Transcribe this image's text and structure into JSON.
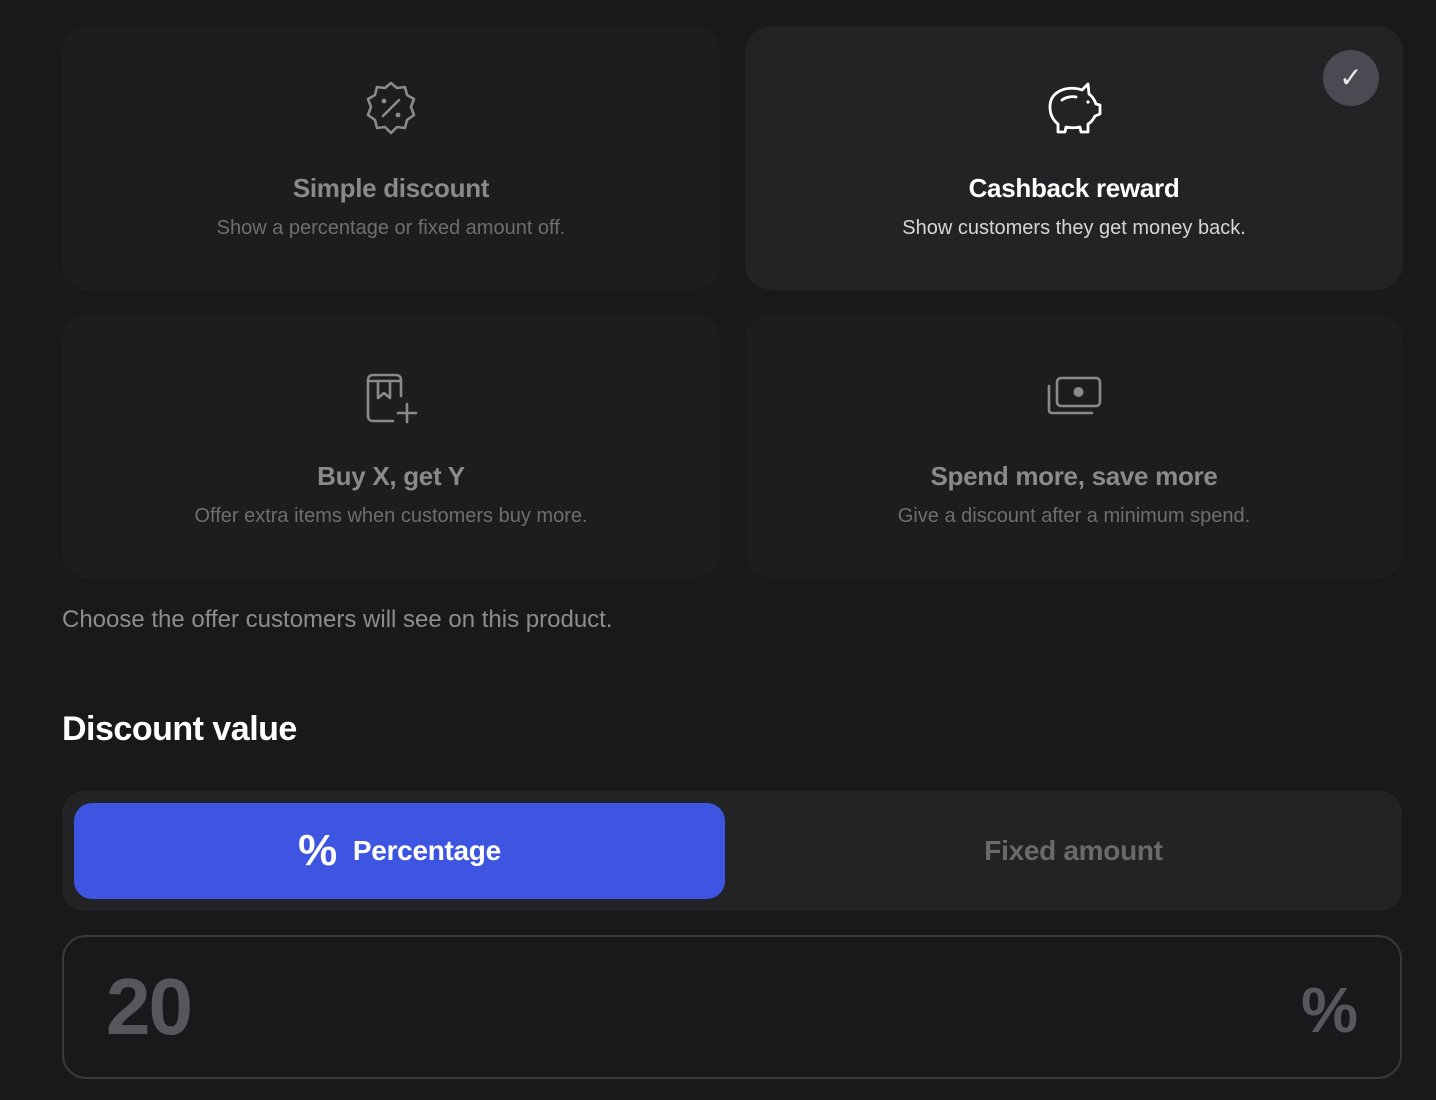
{
  "offers": [
    {
      "title": "Simple discount",
      "description": "Show a percentage or fixed amount off.",
      "icon": "percent-badge-icon",
      "selected": false
    },
    {
      "title": "Cashback reward",
      "description": "Show customers they get money back.",
      "icon": "piggy-bank-icon",
      "selected": true
    },
    {
      "title": "Buy X, get Y",
      "description": "Offer extra items when customers buy more.",
      "icon": "bookmark-plus-icon",
      "selected": false
    },
    {
      "title": "Spend more, save more",
      "description": "Give a discount after a minimum spend.",
      "icon": "banknotes-icon",
      "selected": false
    }
  ],
  "selected_check": "✓",
  "helper_text": "Choose the offer customers will see on this product.",
  "discount": {
    "section_title": "Discount value",
    "options": {
      "percentage": {
        "glyph": "%",
        "label": "Percentage",
        "active": true
      },
      "fixed": {
        "label": "Fixed amount",
        "active": false
      }
    },
    "value": "20",
    "unit": "%"
  },
  "colors": {
    "background": "#19191b",
    "card": "#1d1d1f",
    "card_selected": "#232325",
    "accent": "#3d55e0",
    "check_badge": "#4a4a52"
  }
}
